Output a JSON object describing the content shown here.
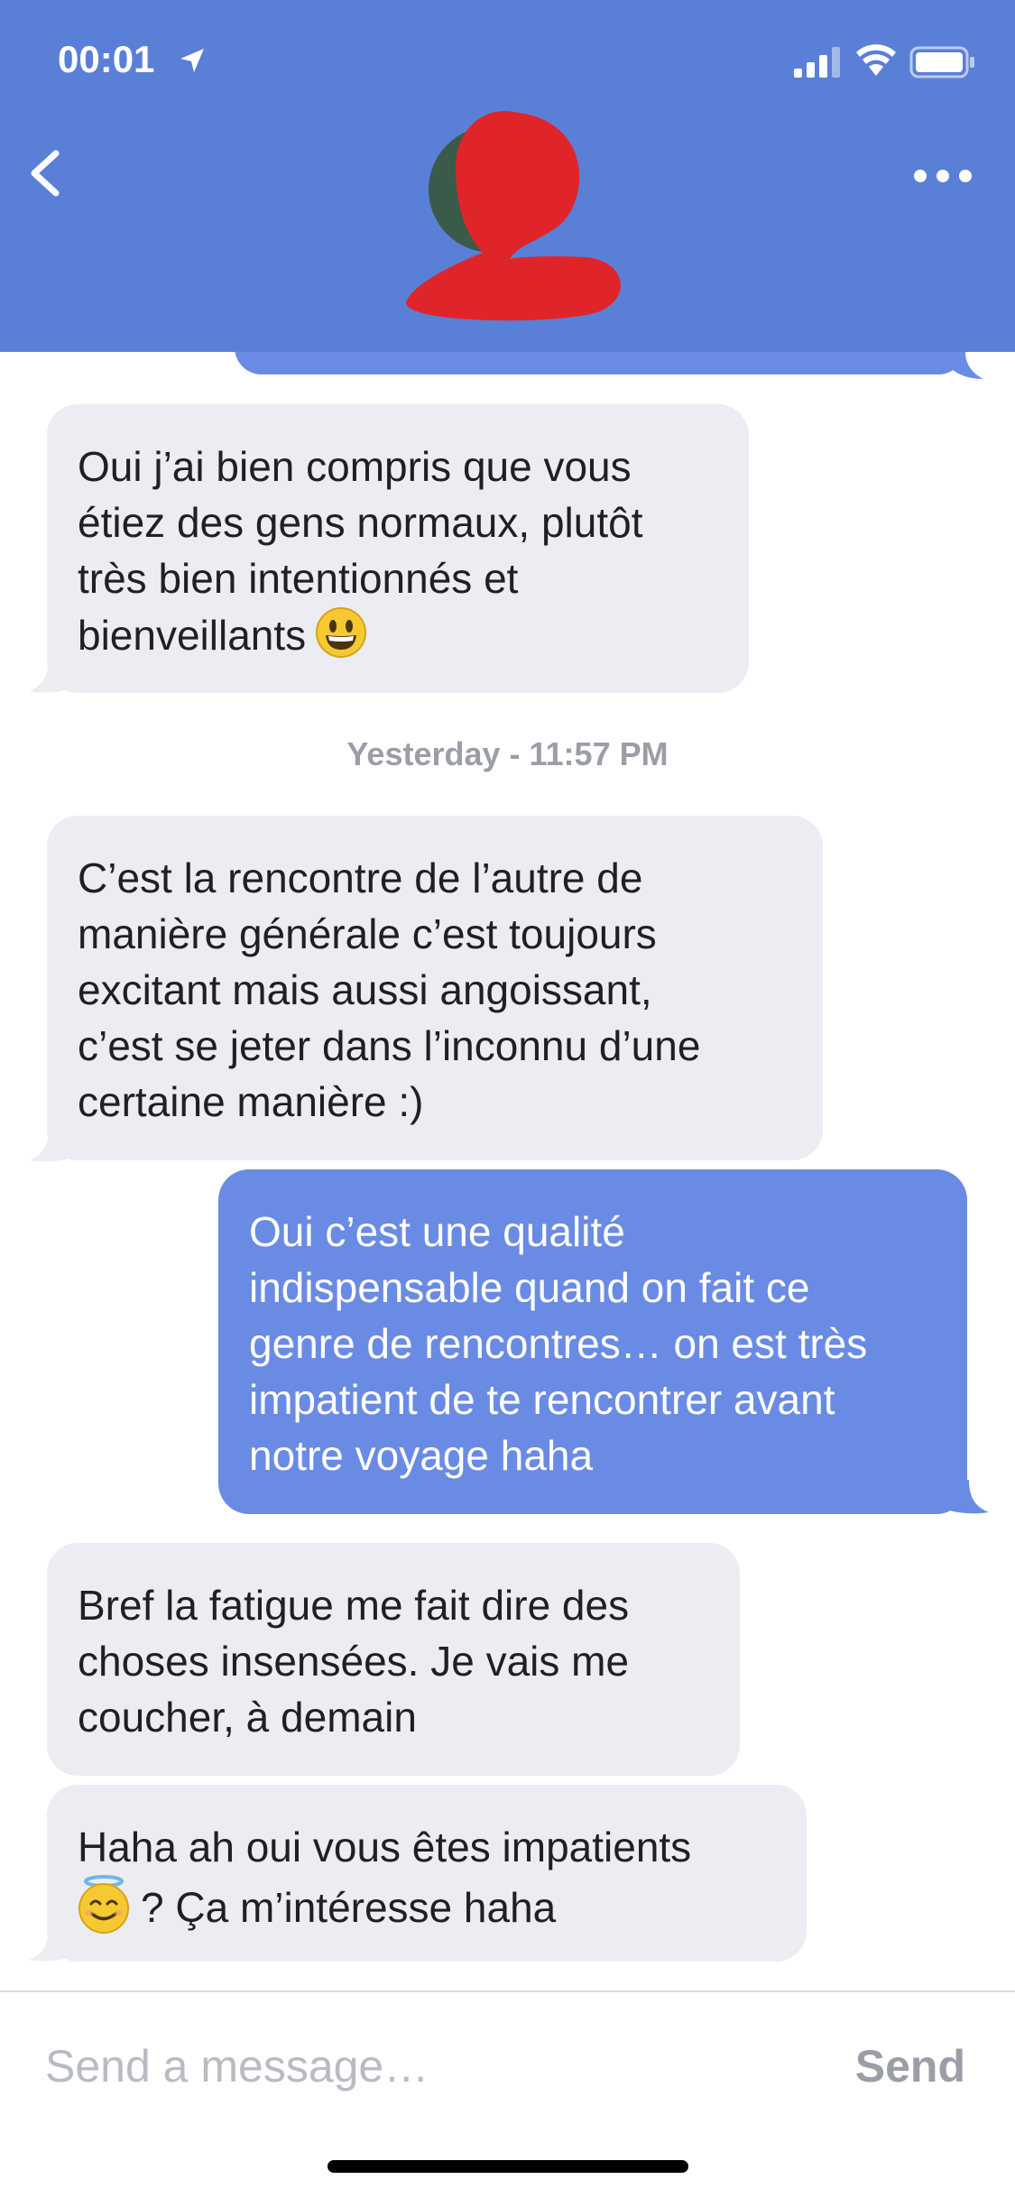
{
  "status_bar": {
    "time": "00:01"
  },
  "header": {
    "back_icon": "chevron-left-icon",
    "more_icon": "ellipsis-icon",
    "color": "#5a7fd6"
  },
  "conversation": {
    "messages": [
      {
        "side": "received",
        "lines": [
          "Oui j’ai bien compris que vous",
          "étiez des gens normaux, plutôt",
          "très bien intentionnés et",
          "bienveillants"
        ],
        "emoji": "grinning-face-emoji"
      },
      {
        "side": "received",
        "lines": [
          "C’est la rencontre de l’autre de",
          "manière générale c’est toujours",
          "excitant mais aussi angoissant,",
          "c’est se jeter dans l’inconnu d’une",
          "certaine manière :)"
        ]
      },
      {
        "side": "sent",
        "lines": [
          "Oui c’est une qualité",
          "indispensable quand on fait ce",
          "genre de rencontres… on est très",
          "impatient de te rencontrer avant",
          "notre voyage haha"
        ]
      },
      {
        "side": "received",
        "lines": [
          "Bref la fatigue me fait dire des",
          "choses insensées. Je vais me",
          "coucher, à demain"
        ]
      },
      {
        "side": "received",
        "lines": [
          "Haha ah oui vous êtes impatients",
          "? Ça m’intéresse haha"
        ],
        "emoji": "smiling-face-with-halo-emoji"
      }
    ],
    "timestamp": "Yesterday - 11:57 PM"
  },
  "composer": {
    "placeholder": "Send a message…",
    "value": "",
    "send_label": "Send"
  },
  "colors": {
    "sent_bubble": "#6a8be4",
    "received_bubble": "#ebedf2",
    "muted_text": "#9b9ea6"
  }
}
